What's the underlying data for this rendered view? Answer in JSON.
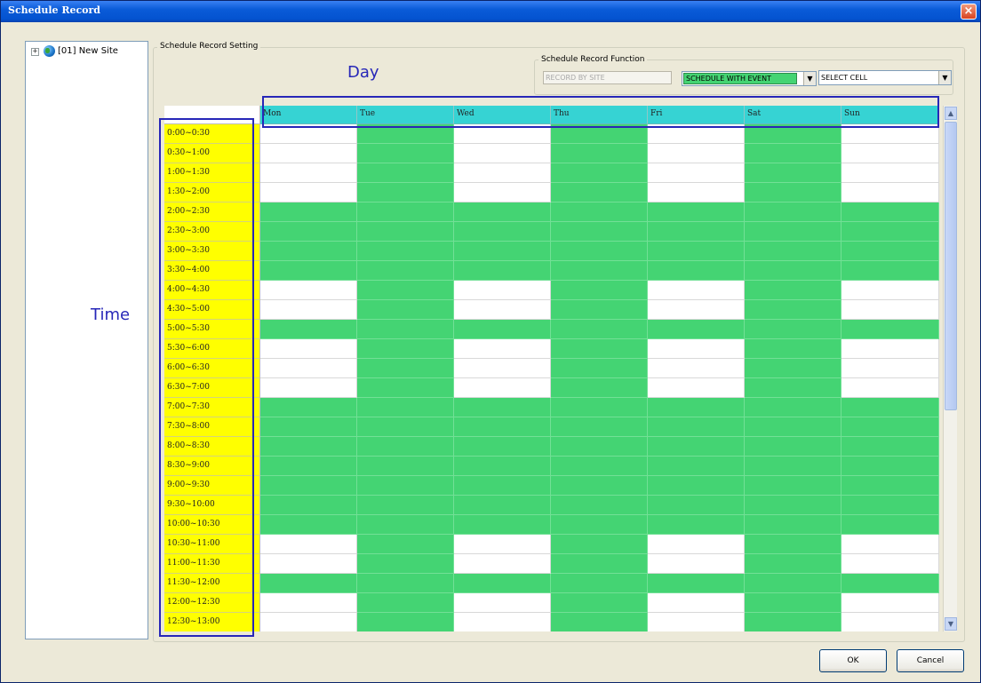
{
  "window": {
    "title": "Schedule Record"
  },
  "tree": {
    "expander": "+",
    "items": [
      {
        "label": "[01] New Site"
      }
    ]
  },
  "schedule": {
    "group_title": "Schedule Record Setting",
    "function_title": "Schedule Record Function",
    "record_by_site": "RECORD BY SITE",
    "mode_value": "SCHEDULE WITH EVENT",
    "select_value": "SELECT CELL",
    "dropdown_glyph": "▼"
  },
  "annotations": {
    "day": "Day",
    "time": "Time"
  },
  "days": [
    "Mon",
    "Tue",
    "Wed",
    "Thu",
    "Fri",
    "Sat",
    "Sun"
  ],
  "time_slots": [
    "0:00~0:30",
    "0:30~1:00",
    "1:00~1:30",
    "1:30~2:00",
    "2:00~2:30",
    "2:30~3:00",
    "3:00~3:30",
    "3:30~4:00",
    "4:00~4:30",
    "4:30~5:00",
    "5:00~5:30",
    "5:30~6:00",
    "6:00~6:30",
    "6:30~7:00",
    "7:00~7:30",
    "7:30~8:00",
    "8:00~8:30",
    "8:30~9:00",
    "9:00~9:30",
    "9:30~10:00",
    "10:00~10:30",
    "10:30~11:00",
    "11:00~11:30",
    "11:30~12:00",
    "12:00~12:30",
    "12:30~13:00",
    ""
  ],
  "grid": [
    [
      0,
      1,
      0,
      1,
      0,
      1,
      0
    ],
    [
      0,
      1,
      0,
      1,
      0,
      1,
      0
    ],
    [
      0,
      1,
      0,
      1,
      0,
      1,
      0
    ],
    [
      0,
      1,
      0,
      1,
      0,
      1,
      0
    ],
    [
      1,
      1,
      1,
      1,
      1,
      1,
      1
    ],
    [
      1,
      1,
      1,
      1,
      1,
      1,
      1
    ],
    [
      1,
      1,
      1,
      1,
      1,
      1,
      1
    ],
    [
      1,
      1,
      1,
      1,
      1,
      1,
      1
    ],
    [
      0,
      1,
      0,
      1,
      0,
      1,
      0
    ],
    [
      0,
      1,
      0,
      1,
      0,
      1,
      0
    ],
    [
      1,
      1,
      1,
      1,
      1,
      1,
      1
    ],
    [
      0,
      1,
      0,
      1,
      0,
      1,
      0
    ],
    [
      0,
      1,
      0,
      1,
      0,
      1,
      0
    ],
    [
      0,
      1,
      0,
      1,
      0,
      1,
      0
    ],
    [
      1,
      1,
      1,
      1,
      1,
      1,
      1
    ],
    [
      1,
      1,
      1,
      1,
      1,
      1,
      1
    ],
    [
      1,
      1,
      1,
      1,
      1,
      1,
      1
    ],
    [
      1,
      1,
      1,
      1,
      1,
      1,
      1
    ],
    [
      1,
      1,
      1,
      1,
      1,
      1,
      1
    ],
    [
      1,
      1,
      1,
      1,
      1,
      1,
      1
    ],
    [
      1,
      1,
      1,
      1,
      1,
      1,
      1
    ],
    [
      0,
      1,
      0,
      1,
      0,
      1,
      0
    ],
    [
      0,
      1,
      0,
      1,
      0,
      1,
      0
    ],
    [
      1,
      1,
      1,
      1,
      1,
      1,
      1
    ],
    [
      0,
      1,
      0,
      1,
      0,
      1,
      0
    ],
    [
      0,
      1,
      0,
      1,
      0,
      1,
      0
    ],
    [
      0,
      1,
      0,
      1,
      0,
      1,
      0
    ]
  ],
  "colors": {
    "scheduled": "#44d473",
    "unscheduled": "#ffffff",
    "day_header": "#36d3d3",
    "time_column": "#ffff00"
  },
  "scrollbar": {
    "up_glyph": "▲",
    "down_glyph": "▼"
  },
  "buttons": {
    "ok": "OK",
    "cancel": "Cancel",
    "close": "×"
  }
}
